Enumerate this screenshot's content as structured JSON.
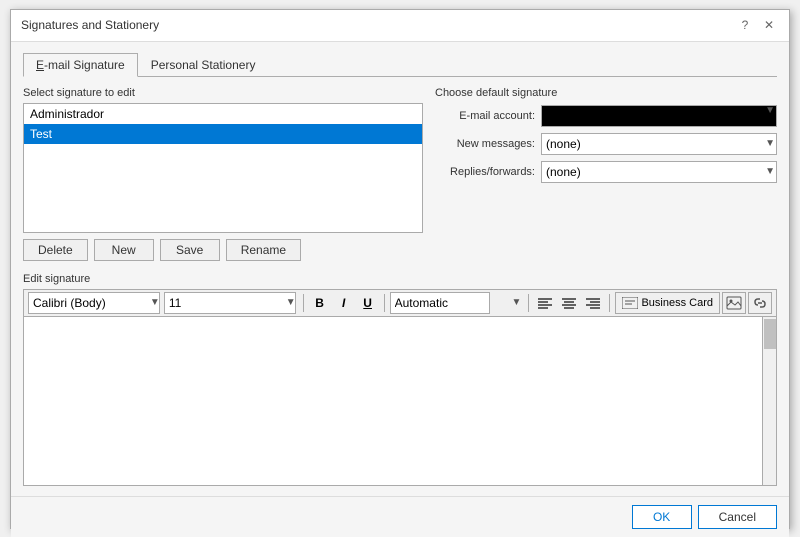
{
  "dialog": {
    "title": "Signatures and Stationery",
    "help_btn": "?",
    "close_btn": "✕"
  },
  "tabs": {
    "email_signature": "E-mail Signature",
    "email_signature_underline": "E",
    "personal_stationery": "Personal Stationery"
  },
  "left": {
    "section_label": "Select signature to edit",
    "signatures": [
      {
        "name": "Administrador",
        "selected": false
      },
      {
        "name": "Test",
        "selected": true
      }
    ],
    "buttons": {
      "delete": "Delete",
      "new": "New",
      "save": "Save",
      "rename": "Rename"
    }
  },
  "right": {
    "section_label": "Choose default signature",
    "email_account_label": "E-mail account:",
    "new_messages_label": "New messages:",
    "replies_label": "Replies/forwards:",
    "new_messages_value": "(none)",
    "replies_value": "(none)",
    "options": [
      "(none)"
    ]
  },
  "edit": {
    "section_label": "Edit signature",
    "font": "Calibri (Body)",
    "size": "11",
    "bold": "B",
    "italic": "I",
    "underline": "U",
    "color_label": "Automatic",
    "align_left": "≡",
    "align_center": "≡",
    "align_right": "≡",
    "business_card": "Business Card",
    "insert_image": "🖼",
    "insert_link": "🔗"
  },
  "footer": {
    "ok": "OK",
    "cancel": "Cancel"
  }
}
